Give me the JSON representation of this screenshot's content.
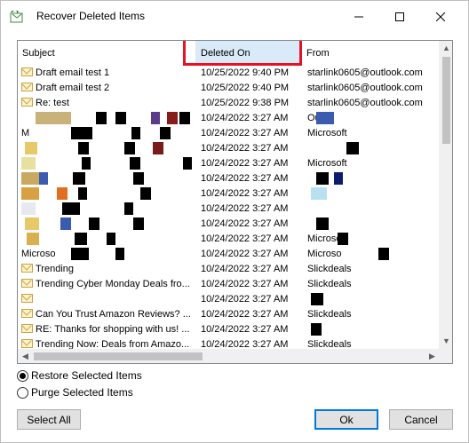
{
  "window": {
    "title": "Recover Deleted Items"
  },
  "columns": {
    "subject": "Subject",
    "deleted": "Deleted On",
    "from": "From"
  },
  "rows": [
    {
      "subject": "Draft email test 1",
      "deleted": "10/25/2022 9:40 PM",
      "from": "starlink0605@outlook.com"
    },
    {
      "subject": "Draft email test 2",
      "deleted": "10/25/2022 9:40 PM",
      "from": "starlink0605@outlook.com"
    },
    {
      "subject": "Re: test",
      "deleted": "10/25/2022 9:38 PM",
      "from": "starlink0605@outlook.com"
    },
    {
      "subject": "",
      "deleted": "10/24/2022 3:27 AM",
      "from": "Out"
    },
    {
      "subject": "M",
      "deleted": "10/24/2022 3:27 AM",
      "from": "Microsoft"
    },
    {
      "subject": "",
      "deleted": "10/24/2022 3:27 AM",
      "from": ""
    },
    {
      "subject": "",
      "deleted": "10/24/2022 3:27 AM",
      "from": "Microsoft"
    },
    {
      "subject": "",
      "deleted": "10/24/2022 3:27 AM",
      "from": ""
    },
    {
      "subject": "",
      "deleted": "10/24/2022 3:27 AM",
      "from": ""
    },
    {
      "subject": "",
      "deleted": "10/24/2022 3:27 AM",
      "from": ""
    },
    {
      "subject": "",
      "deleted": "10/24/2022 3:27 AM",
      "from": ""
    },
    {
      "subject": "",
      "deleted": "10/24/2022 3:27 AM",
      "from": "Microsoft"
    },
    {
      "subject": "Microso",
      "deleted": "10/24/2022 3:27 AM",
      "from": "Microso"
    },
    {
      "subject": "Trending",
      "deleted": "10/24/2022 3:27 AM",
      "from": "Slickdeals"
    },
    {
      "subject": "Trending Cyber Monday Deals fro...",
      "deleted": "10/24/2022 3:27 AM",
      "from": "Slickdeals"
    },
    {
      "subject": "",
      "deleted": "10/24/2022 3:27 AM",
      "from": ""
    },
    {
      "subject": "Can You Trust Amazon Reviews? ...",
      "deleted": "10/24/2022 3:27 AM",
      "from": "Slickdeals"
    },
    {
      "subject": "RE: Thanks for shopping with us! ...",
      "deleted": "10/24/2022 3:27 AM",
      "from": ""
    },
    {
      "subject": "Trending Now: Deals from Amazo...",
      "deleted": "10/24/2022 3:27 AM",
      "from": "Slickdeals"
    },
    {
      "subject": "",
      "deleted": "10/24/2022 3:27 AM",
      "from": ""
    }
  ],
  "options": {
    "restore_label": "Restore Selected Items",
    "purge_label": "Purge Selected Items",
    "selected": "restore"
  },
  "buttons": {
    "select_all": "Select All",
    "ok": "Ok",
    "cancel": "Cancel"
  },
  "colors": {
    "highlight": "#e81123",
    "header_selected": "#d9ebf9",
    "ok_border": "#0078d7"
  }
}
